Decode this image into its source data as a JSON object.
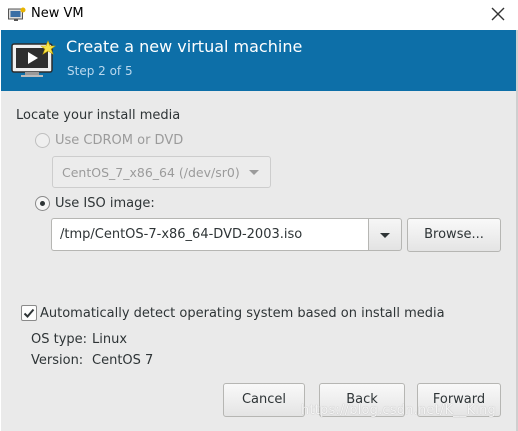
{
  "window": {
    "title": "New VM",
    "icon": "vm-manager-icon",
    "close_icon": "close-icon"
  },
  "header": {
    "title": "Create a new virtual machine",
    "step": "Step 2 of 5",
    "icon": "new-vm-screen-icon",
    "background_color": "#0d6fa8"
  },
  "install_media": {
    "section_label": "Locate your install media",
    "cdrom": {
      "label": "Use CDROM or DVD",
      "selected": false,
      "enabled": false,
      "device_value": "CentOS_7_x86_64 (/dev/sr0)"
    },
    "iso": {
      "label": "Use ISO image:",
      "selected": true,
      "path_value": "/tmp/CentOS-7-x86_64-DVD-2003.iso",
      "browse_label": "Browse..."
    }
  },
  "os_detect": {
    "label": "Automatically detect operating system based on install media",
    "checked": true,
    "os_type_label": "OS type:",
    "os_type_value": "Linux",
    "version_label": "Version:",
    "version_value": "CentOS 7"
  },
  "buttons": {
    "cancel": "Cancel",
    "back": "Back",
    "forward": "Forward"
  },
  "watermark": "https://blog.csdn.net/K__King"
}
